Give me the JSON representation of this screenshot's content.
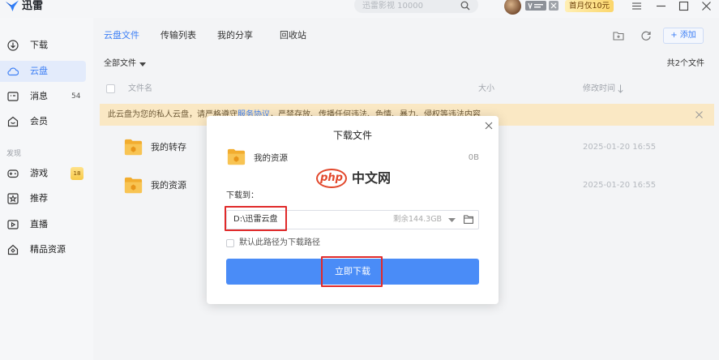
{
  "app": {
    "logo_text": "迅雷",
    "search_placeholder": "迅雷影视 10000"
  },
  "topbar": {
    "promo_label": "首月仅10元",
    "icons": [
      "search-icon",
      "avatar",
      "vip-badge-icon",
      "menu-icon",
      "minimize-icon",
      "maximize-icon",
      "close-icon"
    ]
  },
  "sidebar": {
    "items": [
      {
        "label": "下载",
        "icon": "download-icon"
      },
      {
        "label": "云盘",
        "icon": "cloud-icon",
        "selected": true
      },
      {
        "label": "消息",
        "icon": "message-icon",
        "badge": "54"
      },
      {
        "label": "会员",
        "icon": "member-icon"
      }
    ],
    "section_title": "发现",
    "discover_items": [
      {
        "label": "游戏",
        "icon": "gamepad-icon",
        "badge": "18"
      },
      {
        "label": "推荐",
        "icon": "star-icon"
      },
      {
        "label": "直播",
        "icon": "live-icon"
      },
      {
        "label": "精品资源",
        "icon": "gem-icon"
      }
    ]
  },
  "main": {
    "tabs": [
      {
        "label": "云盘文件",
        "active": true
      },
      {
        "label": "传输列表"
      },
      {
        "label": "我的分享"
      },
      {
        "label": "回收站"
      }
    ],
    "add_button": {
      "icon": "plus-icon",
      "label": "添加"
    },
    "filter_label": "全部文件",
    "file_count": "共2个文件",
    "columns": {
      "name": "文件名",
      "size": "大小",
      "modified": "修改时间"
    },
    "banner": {
      "prefix": "此云盘为您的私人云盘，请严格遵守",
      "link": "服务协议",
      "suffix": "，严禁存放、传播任何违法、色情、暴力、侵权等违法内容"
    },
    "files": [
      {
        "name": "我的转存",
        "modified": "2025-01-20 16:55",
        "icon": "folder-icon"
      },
      {
        "name": "我的资源",
        "modified": "2025-01-20 16:55",
        "icon": "folder-icon"
      }
    ]
  },
  "dialog": {
    "title": "下载文件",
    "file_name": "我的资源",
    "file_size": "0B",
    "path_label": "下载到：",
    "path_value": "D:\\迅雷云盘",
    "free_space": "剩余144.3GB",
    "default_checkbox_label": "默认此路径为下载路径",
    "default_checked": false,
    "download_button": "立即下载"
  },
  "watermark": {
    "brand": "php",
    "site": "中文网"
  },
  "colors": {
    "accent": "#3d7ff5",
    "button": "#4a8cf7",
    "banner": "#fae8c4",
    "promo": "#fbd66b",
    "folder": "#f6b73c",
    "annotation": "#e02a2a"
  }
}
